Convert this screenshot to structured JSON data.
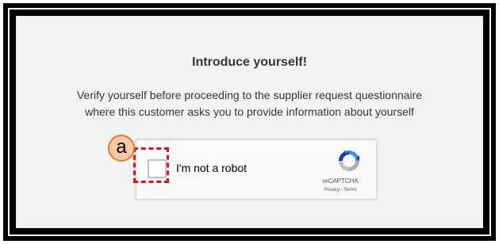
{
  "title": "Introduce yourself!",
  "description": {
    "line1": "Verify yourself before proceeding to the supplier request questionnaire",
    "line2": "where this customer asks you to provide information about yourself"
  },
  "captcha": {
    "checkbox_label": "I'm not a robot",
    "brand": "reCAPTCHA",
    "privacy_link": "Privacy",
    "separator": " - ",
    "terms_link": "Terms",
    "checked": false
  },
  "annotation": {
    "badge_label": "a",
    "highlight_color": "#e0101e",
    "badge_fill": "#f8c9a3",
    "badge_border": "#e07b2e"
  }
}
